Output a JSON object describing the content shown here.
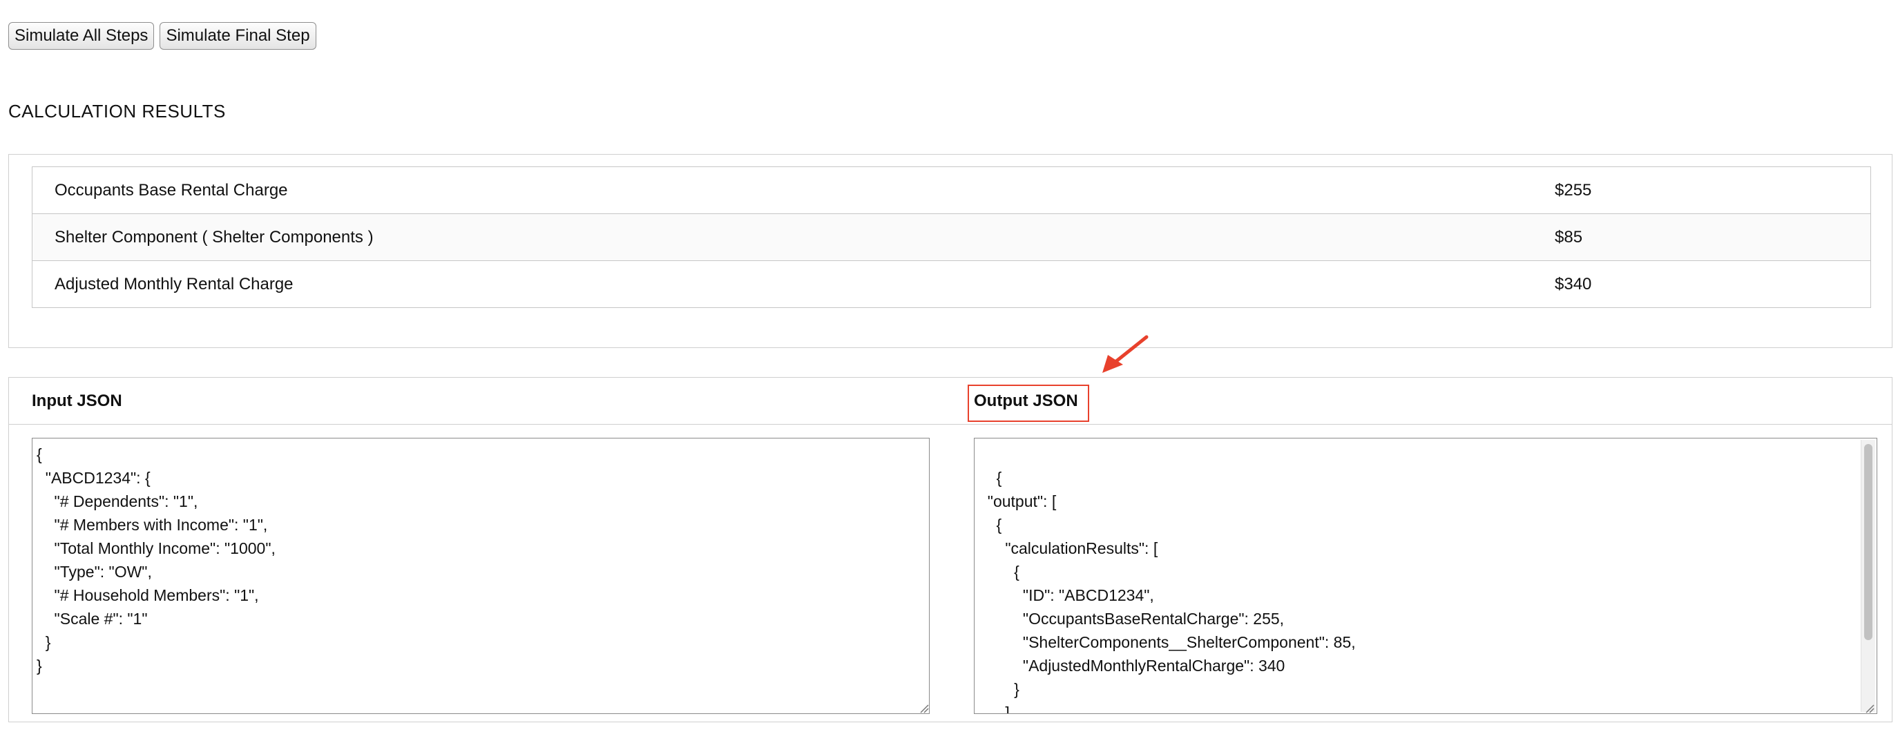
{
  "toolbar": {
    "simulate_all_label": "Simulate All Steps",
    "simulate_final_label": "Simulate Final Step"
  },
  "results": {
    "title": "CALCULATION RESULTS",
    "rows": [
      {
        "label": "Occupants Base Rental Charge",
        "value": "$255"
      },
      {
        "label": "Shelter Component ( Shelter Components )",
        "value": "$85"
      },
      {
        "label": "Adjusted Monthly Rental Charge",
        "value": "$340"
      }
    ]
  },
  "json_panel": {
    "input_label": "Input JSON",
    "output_label": "Output JSON",
    "input_text": "{\n  \"ABCD1234\": {\n    \"# Dependents\": \"1\",\n    \"# Members with Income\": \"1\",\n    \"Total Monthly Income\": \"1000\",\n    \"Type\": \"OW\",\n    \"# Household Members\": \"1\",\n    \"Scale #\": \"1\"\n  }\n}",
    "output_text": "{\n  \"output\": [\n    {\n      \"calculationResults\": [\n        {\n          \"ID\": \"ABCD1234\",\n          \"OccupantsBaseRentalCharge\": 255,\n          \"ShelterComponents__ShelterComponent\": 85,\n          \"AdjustedMonthlyRentalCharge\": 340\n        }\n      ]\n    }"
  },
  "colors": {
    "annotation": "#e8412c",
    "border": "#cfcfcf"
  },
  "icons": {
    "annotation_arrow": "arrow-icon",
    "resize_handle": "resize-grip-icon"
  }
}
